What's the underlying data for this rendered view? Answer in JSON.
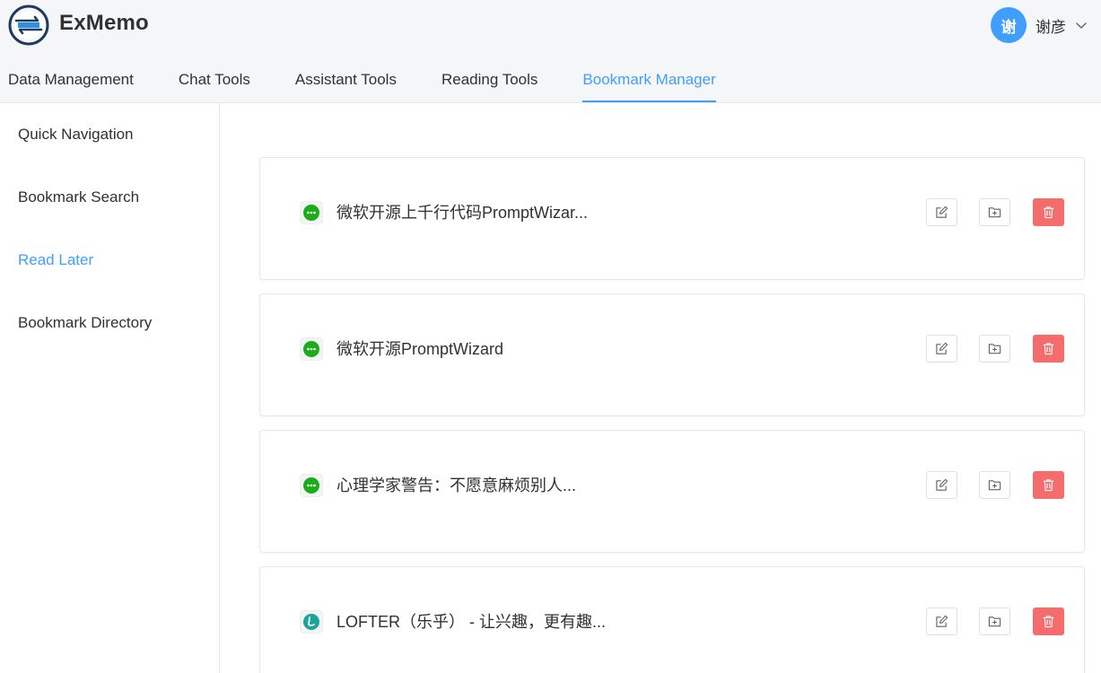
{
  "app": {
    "title": "ExMemo",
    "logo_icon": "exmemo-logo-icon"
  },
  "user": {
    "avatar_text": "谢",
    "name": "谢彦"
  },
  "tabs": [
    {
      "label": "Data Management",
      "active": false
    },
    {
      "label": "Chat Tools",
      "active": false
    },
    {
      "label": "Assistant Tools",
      "active": false
    },
    {
      "label": "Reading Tools",
      "active": false
    },
    {
      "label": "Bookmark Manager",
      "active": true
    }
  ],
  "sidebar": {
    "items": [
      {
        "label": "Quick Navigation",
        "active": false
      },
      {
        "label": "Bookmark Search",
        "active": false
      },
      {
        "label": "Read Later",
        "active": true
      },
      {
        "label": "Bookmark Directory",
        "active": false
      }
    ]
  },
  "bookmarks": [
    {
      "title": "微软开源上千行代码PromptWizar...",
      "source_icon": "wechat-icon"
    },
    {
      "title": "微软开源PromptWizard",
      "source_icon": "wechat-icon"
    },
    {
      "title": "心理学家警告：不愿意麻烦别人...",
      "source_icon": "wechat-icon"
    },
    {
      "title": "LOFTER（乐乎） - 让兴趣，更有趣...",
      "source_icon": "lofter-icon"
    }
  ],
  "actions": {
    "edit_icon": "edit-icon",
    "move_icon": "folder-plus-icon",
    "delete_icon": "trash-icon"
  },
  "colors": {
    "accent": "#409eff",
    "danger": "#f56c6c",
    "wechat": "#1aad19",
    "lofter": "#1aa49a"
  }
}
